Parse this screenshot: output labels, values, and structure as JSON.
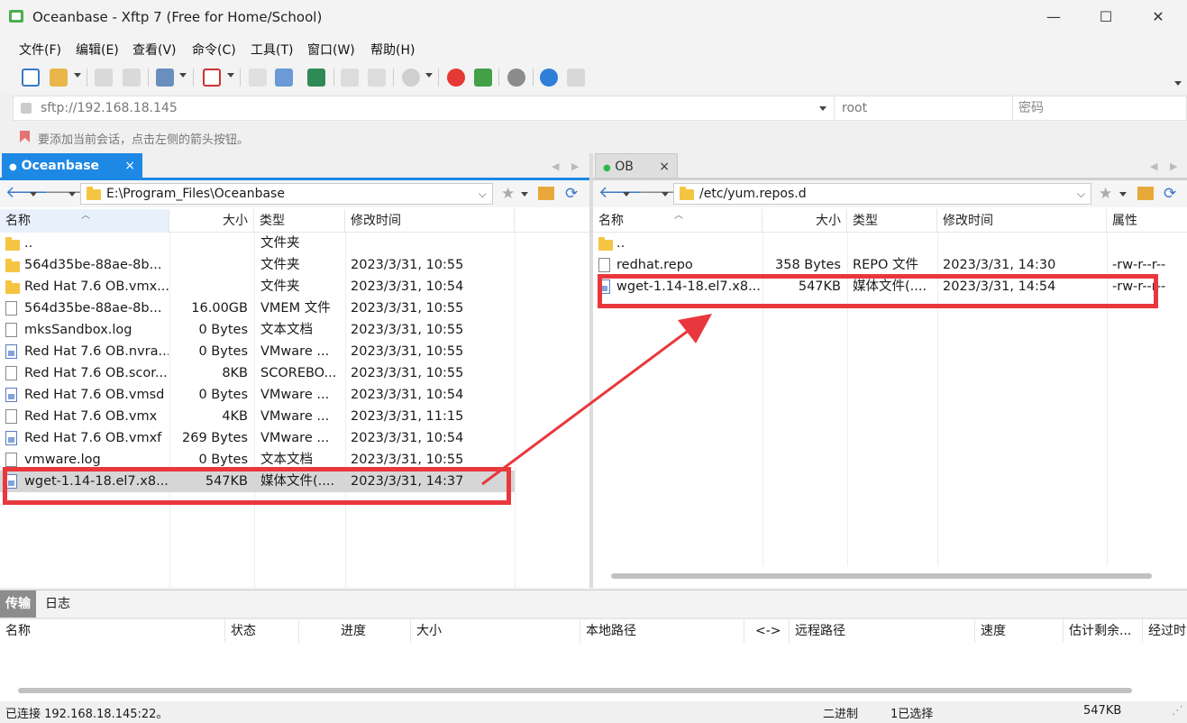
{
  "window": {
    "title": "Oceanbase - Xftp 7 (Free for Home/School)",
    "min_glyph": "—",
    "max_glyph": "☐",
    "close_glyph": "✕"
  },
  "menu": [
    "文件(F)",
    "编辑(E)",
    "查看(V)",
    "命令(C)",
    "工具(T)",
    "窗口(W)",
    "帮助(H)"
  ],
  "address": {
    "host": "sftp://192.168.18.145",
    "user_placeholder": "root",
    "password_placeholder": "密码"
  },
  "hint": "要添加当前会话，点击左侧的箭头按钮。",
  "left_pane": {
    "tab": "Oceanbase",
    "tab_close": "×",
    "path": "E:\\Program_Files\\Oceanbase",
    "columns": [
      "名称",
      "大小",
      "类型",
      "修改时间"
    ],
    "rows": [
      {
        "name": "..",
        "size": "",
        "type": "文件夹",
        "mtime": "",
        "icon": "folder"
      },
      {
        "name": "564d35be-88ae-8b...",
        "size": "",
        "type": "文件夹",
        "mtime": "2023/3/31, 10:55",
        "icon": "folder"
      },
      {
        "name": "Red Hat 7.6 OB.vmx...",
        "size": "",
        "type": "文件夹",
        "mtime": "2023/3/31, 10:54",
        "icon": "folder"
      },
      {
        "name": "564d35be-88ae-8b...",
        "size": "16.00GB",
        "type": "VMEM 文件",
        "mtime": "2023/3/31, 10:55",
        "icon": "file"
      },
      {
        "name": "mksSandbox.log",
        "size": "0 Bytes",
        "type": "文本文档",
        "mtime": "2023/3/31, 10:55",
        "icon": "file"
      },
      {
        "name": "Red Hat 7.6 OB.nvra...",
        "size": "0 Bytes",
        "type": "VMware ...",
        "mtime": "2023/3/31, 10:55",
        "icon": "media"
      },
      {
        "name": "Red Hat 7.6 OB.scor...",
        "size": "8KB",
        "type": "SCOREBO...",
        "mtime": "2023/3/31, 10:55",
        "icon": "file"
      },
      {
        "name": "Red Hat 7.6 OB.vmsd",
        "size": "0 Bytes",
        "type": "VMware ...",
        "mtime": "2023/3/31, 10:54",
        "icon": "media"
      },
      {
        "name": "Red Hat 7.6 OB.vmx",
        "size": "4KB",
        "type": "VMware ...",
        "mtime": "2023/3/31, 11:15",
        "icon": "file"
      },
      {
        "name": "Red Hat 7.6 OB.vmxf",
        "size": "269 Bytes",
        "type": "VMware ...",
        "mtime": "2023/3/31, 10:54",
        "icon": "media"
      },
      {
        "name": "vmware.log",
        "size": "0 Bytes",
        "type": "文本文档",
        "mtime": "2023/3/31, 10:55",
        "icon": "file"
      },
      {
        "name": "wget-1.14-18.el7.x8...",
        "size": "547KB",
        "type": "媒体文件(....",
        "mtime": "2023/3/31, 14:37",
        "icon": "media",
        "selected": true
      }
    ]
  },
  "right_pane": {
    "tab": "OB",
    "tab_close": "×",
    "path": "/etc/yum.repos.d",
    "columns": [
      "名称",
      "大小",
      "类型",
      "修改时间",
      "属性"
    ],
    "rows": [
      {
        "name": "..",
        "size": "",
        "type": "",
        "mtime": "",
        "attr": "",
        "icon": "folder"
      },
      {
        "name": "redhat.repo",
        "size": "358 Bytes",
        "type": "REPO 文件",
        "mtime": "2023/3/31, 14:30",
        "attr": "-rw-r--r--",
        "icon": "file"
      },
      {
        "name": "wget-1.14-18.el7.x8...",
        "size": "547KB",
        "type": "媒体文件(....",
        "mtime": "2023/3/31, 14:54",
        "attr": "-rw-r--r--",
        "icon": "media"
      }
    ]
  },
  "transfer": {
    "tabs": [
      "传输",
      "日志"
    ],
    "columns": [
      "名称",
      "状态",
      "进度",
      "大小",
      "本地路径",
      "<->",
      "远程路径",
      "速度",
      "估计剩余...",
      "经过时"
    ]
  },
  "status": {
    "connection": "已连接 192.168.18.145:22。",
    "mode": "二进制",
    "selection": "1已选择",
    "size": "547KB"
  },
  "colors": {
    "accent": "#1e88e5",
    "annotation": "#e8383d",
    "connected": "#2db84d"
  }
}
